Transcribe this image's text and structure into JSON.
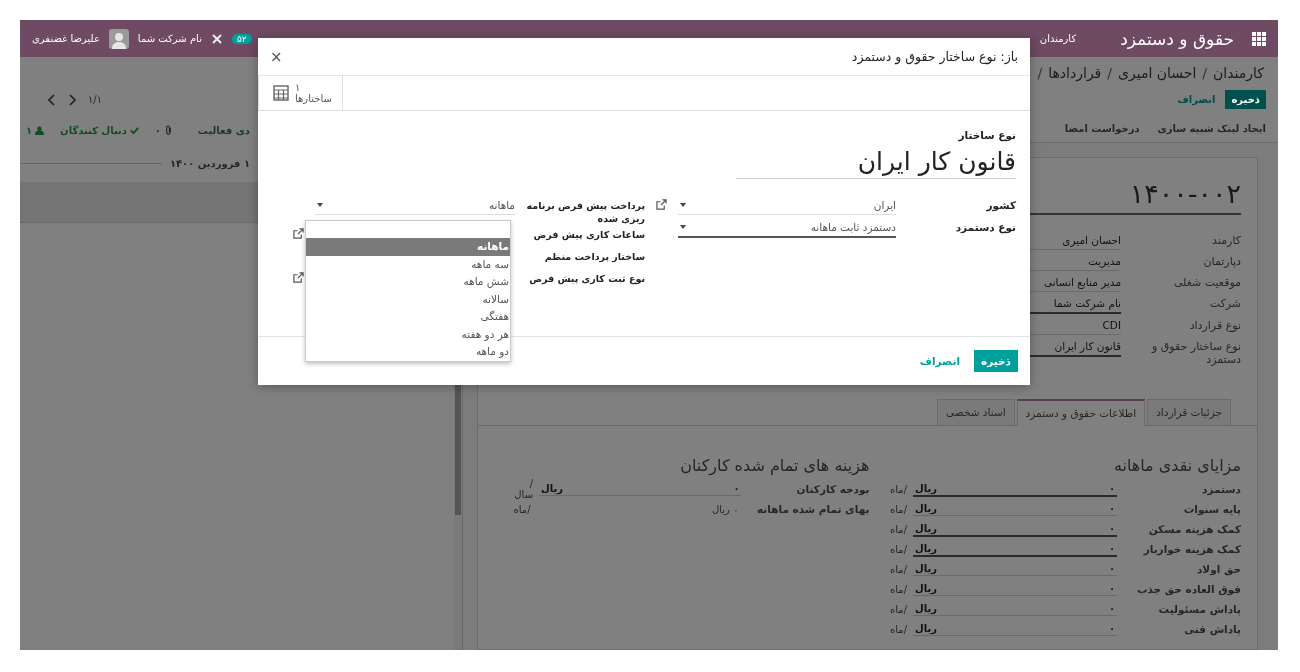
{
  "navbar": {
    "app_name": "حقوق و دستمزد",
    "menu": [
      "کارمندان"
    ],
    "badge": "۵۲",
    "company": "نام شرکت شما",
    "user": "علیرضا غضنفری"
  },
  "breadcrumb": [
    {
      "label": "کارمندان",
      "separator": "/"
    },
    {
      "label": "احسان امیری",
      "separator": "/"
    },
    {
      "label": "قراردادها",
      "separator": "/"
    }
  ],
  "actions": {
    "save": "ذخیره",
    "discard": "انصراف"
  },
  "pager": "۱/۱",
  "header_buttons": [
    "ایجاد لینک شبیه سازی",
    "درخواست امضا"
  ],
  "chatter": {
    "activity": "دی فعالیت",
    "attachments": "۰",
    "following": "دنبال کنندگان",
    "followers": "۱",
    "date": "۱ فروردین ۱۴۰۰"
  },
  "contract": {
    "reference": "۱۴۰۰-۰۰۲",
    "fields": [
      {
        "label": "کارمند",
        "value": "احسان امیری",
        "required": false
      },
      {
        "label": "دپارتمان",
        "value": "مدیریت",
        "required": false
      },
      {
        "label": "موقعیت شغلی",
        "value": "مدیر منابع انسانی",
        "required": false
      },
      {
        "label": "شرکت",
        "value": "نام شرکت شما",
        "required": true
      },
      {
        "label": "نوع قرارداد",
        "value": "CDI",
        "required": false
      },
      {
        "label": "نوع ساختار حقوق و دستمزد",
        "value": "قانون کار ایران",
        "required": true
      }
    ]
  },
  "tabs": [
    {
      "label": "جزئیات قرارداد",
      "selected": false
    },
    {
      "label": "اطلاعات حقوق و دستمزد",
      "selected": true
    },
    {
      "label": "اسناد شخصی",
      "selected": false
    }
  ],
  "benefits": {
    "title": "مزایای نقدی ماهانه",
    "rows": [
      {
        "label": "دستمزد",
        "value": "۰",
        "currency": "ریال",
        "period": "/ماه",
        "required": true
      },
      {
        "label": "پایه سنوات",
        "value": "۰",
        "currency": "ریال",
        "period": "/ماه",
        "required": false
      },
      {
        "label": "کمک هزینه مسکن",
        "value": "۰",
        "currency": "ریال",
        "period": "/ماه",
        "required": true
      },
      {
        "label": "کمک هزینه خواربار",
        "value": "۰",
        "currency": "ریال",
        "period": "/ماه",
        "required": true
      },
      {
        "label": "حق اولاد",
        "value": "۰",
        "currency": "ریال",
        "period": "/ماه",
        "required": false
      },
      {
        "label": "فوق العاده حق جذب",
        "value": "۰",
        "currency": "ریال",
        "period": "/ماه",
        "required": false
      },
      {
        "label": "پاداش مسئولیت",
        "value": "۰",
        "currency": "ریال",
        "period": "/ماه",
        "required": false
      },
      {
        "label": "پاداش فنی",
        "value": "۰",
        "currency": "ریال",
        "period": "/ماه",
        "required": false
      }
    ]
  },
  "costs": {
    "title": "هزینه های تمام شده کارکنان",
    "rows": [
      {
        "kind": "input",
        "label": "بودجه کارکنان",
        "value": "۰",
        "currency": "ریال",
        "period": "/ سال"
      },
      {
        "kind": "readonly",
        "label": "بهای تمام شده ماهانه",
        "value": "۰ ریال",
        "period": "/ماه"
      }
    ]
  },
  "dialog": {
    "title": "باز: نوع ساختار حقوق و دستمزد",
    "close": "×",
    "smart_button": {
      "count": "۱",
      "label": "ساختارها"
    },
    "name_label": "نوع ساختار",
    "name": "قانون کار ایران",
    "left_fields": [
      {
        "label": "کشور",
        "value": "ایران",
        "link": true,
        "required": false
      },
      {
        "label": "نوع دستمزد",
        "value": "دستمزد ثابت ماهانه",
        "link": false,
        "required": true
      }
    ],
    "right_fields": [
      {
        "label": "پرداخت پیش فرض برنامه ریزی شده",
        "value": "ماهانه",
        "link": false
      },
      {
        "label": "ساعات کاری پیش فرض",
        "link": true
      },
      {
        "label": "ساختار پرداخت منظم",
        "link": false
      },
      {
        "label": "نوع ثبت کاری پیش فرض",
        "link": true
      }
    ],
    "dropdown": [
      {
        "label": "ماهانه",
        "selected": true
      },
      {
        "label": "سه ماهه",
        "selected": false
      },
      {
        "label": "شش ماهه",
        "selected": false
      },
      {
        "label": "سالانه",
        "selected": false
      },
      {
        "label": "هفتگی",
        "selected": false
      },
      {
        "label": "هر دو هفته",
        "selected": false
      },
      {
        "label": "دو ماهه",
        "selected": false
      }
    ],
    "save": "ذخیره",
    "discard": "انصراف"
  }
}
